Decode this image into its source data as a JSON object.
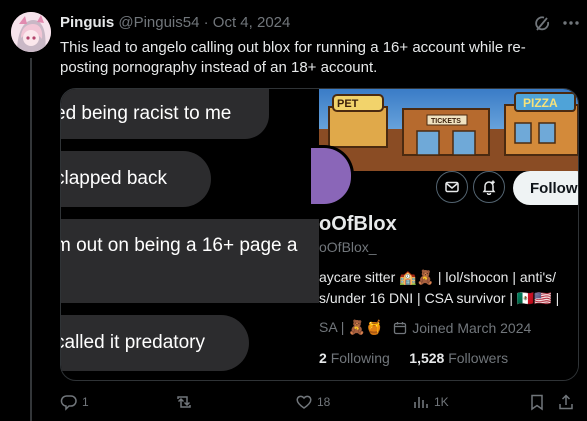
{
  "tweet": {
    "display_name": "Pinguis",
    "handle": "@Pinguis54",
    "separator": "·",
    "date": "Oct 4, 2024",
    "text": "This lead to angelo calling out blox for running a 16+ account while re-posting pornography instead of an 18+ account."
  },
  "media": {
    "chat_bubbles": [
      "ed being racist to me",
      "clapped back",
      "m out on being a 16+ page a",
      "called it predatory"
    ],
    "profile": {
      "name": "oOfBlox",
      "handle": "oOfBlox_",
      "bio_line1": "aycare sitter 🏫🧸 | lol/shocon | anti's/",
      "bio_line2": "s/under 16 DNI | CSA survivor | 🇲🇽🇺🇸 |",
      "meta_prefix": "SA | 🧸🍯",
      "joined": "Joined March 2024",
      "following_count": "2",
      "following_label": "Following",
      "followers_count": "1,528",
      "followers_label": "Followers",
      "follow_button": "Followi",
      "banner_signs": [
        "PET",
        "PIZZA",
        "TICKETS"
      ]
    }
  },
  "actions": {
    "replies": "1",
    "reposts": "",
    "likes": "18",
    "views": "1K"
  },
  "icons": {
    "grok": "grok-icon",
    "more": "more-icon",
    "reply": "reply-icon",
    "repost": "repost-icon",
    "like": "heart-icon",
    "views": "views-icon",
    "bookmark": "bookmark-icon",
    "share": "share-icon"
  }
}
